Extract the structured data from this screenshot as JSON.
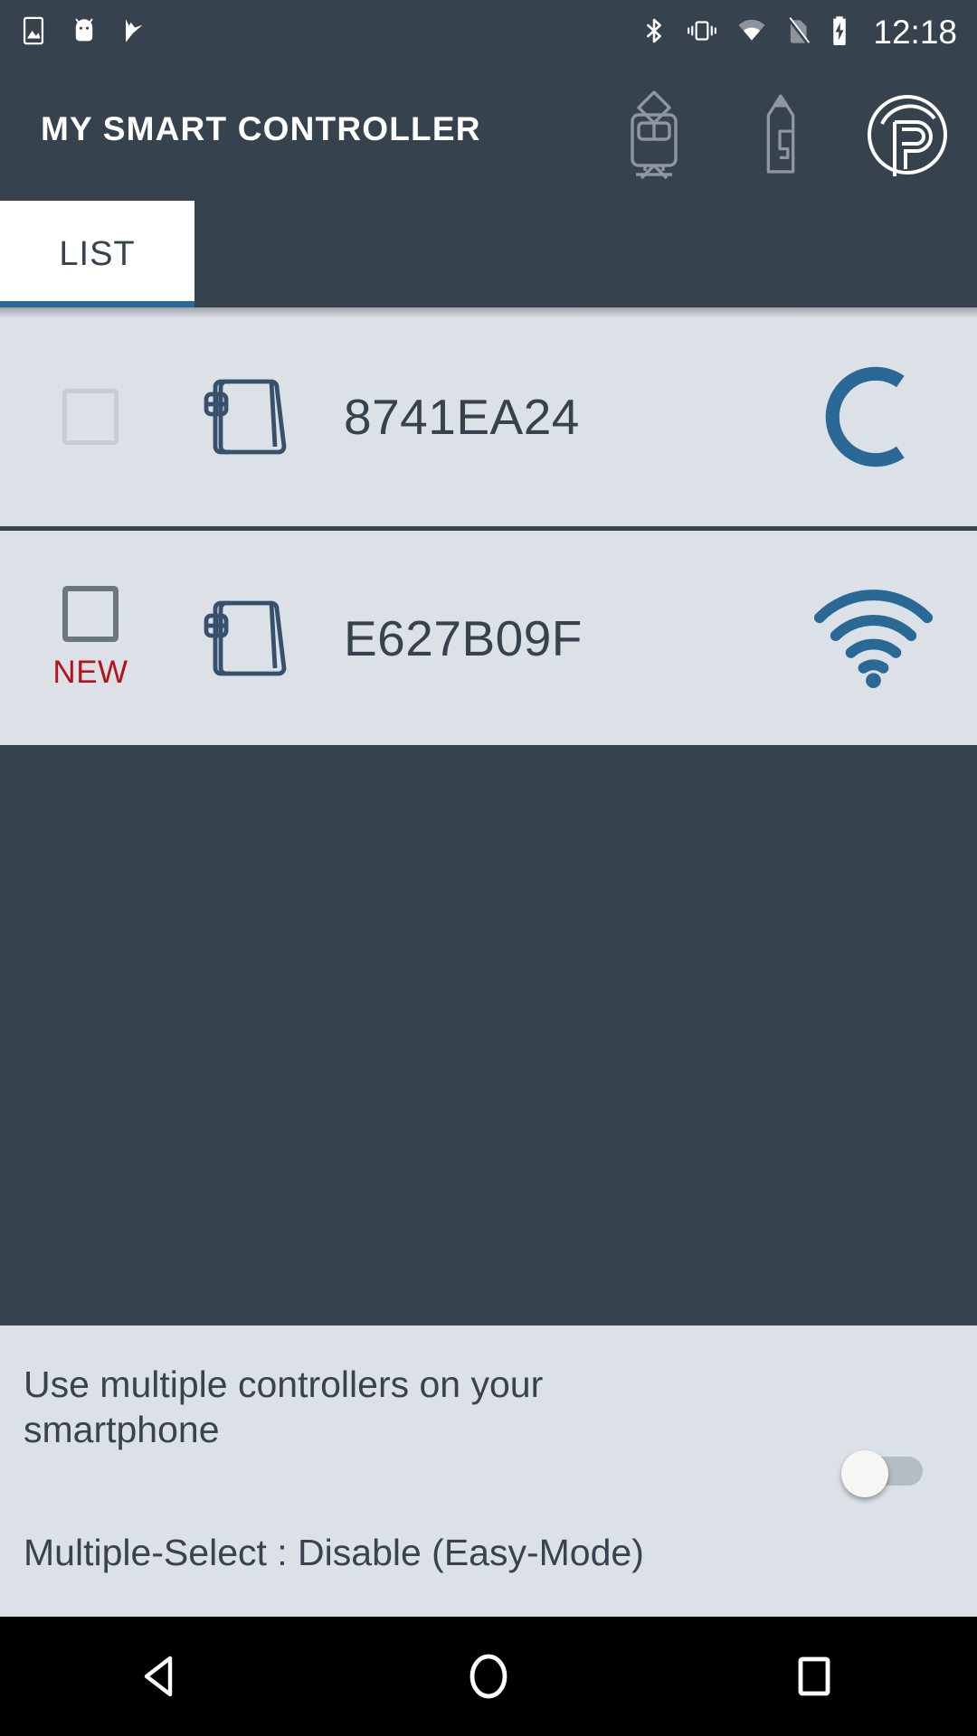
{
  "status_bar": {
    "time": "12:18",
    "left_icons": [
      "image-icon",
      "android-icon",
      "checkmark-flag-icon"
    ],
    "right_icons": [
      "bluetooth-icon",
      "vibrate-icon",
      "wifi-icon",
      "sim-off-icon",
      "battery-charging-icon"
    ]
  },
  "app_bar": {
    "title": "MY SMART CONTROLLER",
    "actions": [
      {
        "name": "tram-controller-icon"
      },
      {
        "name": "pen-tool-icon"
      },
      {
        "name": "brand-p-logo-icon"
      }
    ]
  },
  "tabs": [
    {
      "label": "LIST",
      "selected": true
    }
  ],
  "list": {
    "rows": [
      {
        "id": "8741EA24",
        "checked": false,
        "checkbox_style": "light",
        "badge": "",
        "device_icon": "controller-device-icon",
        "status_icon": "loading-spinner-icon"
      },
      {
        "id": "E627B09F",
        "checked": false,
        "checkbox_style": "dark",
        "badge": "NEW",
        "device_icon": "controller-device-icon",
        "status_icon": "wifi-signal-icon"
      }
    ]
  },
  "bottom_panel": {
    "description": "Use multiple controllers on your smartphone",
    "mode_text": "Multiple-Select : Disable (Easy-Mode)",
    "toggle_on": false
  },
  "nav_bar": {
    "buttons": [
      {
        "name": "back-button"
      },
      {
        "name": "home-button"
      },
      {
        "name": "recents-button"
      }
    ]
  },
  "colors": {
    "chrome": "#36424e",
    "list_bg": "#dce1e8",
    "accent_blue": "#2a6896",
    "badge_red": "#b5121b",
    "text_dark": "#37434f"
  }
}
